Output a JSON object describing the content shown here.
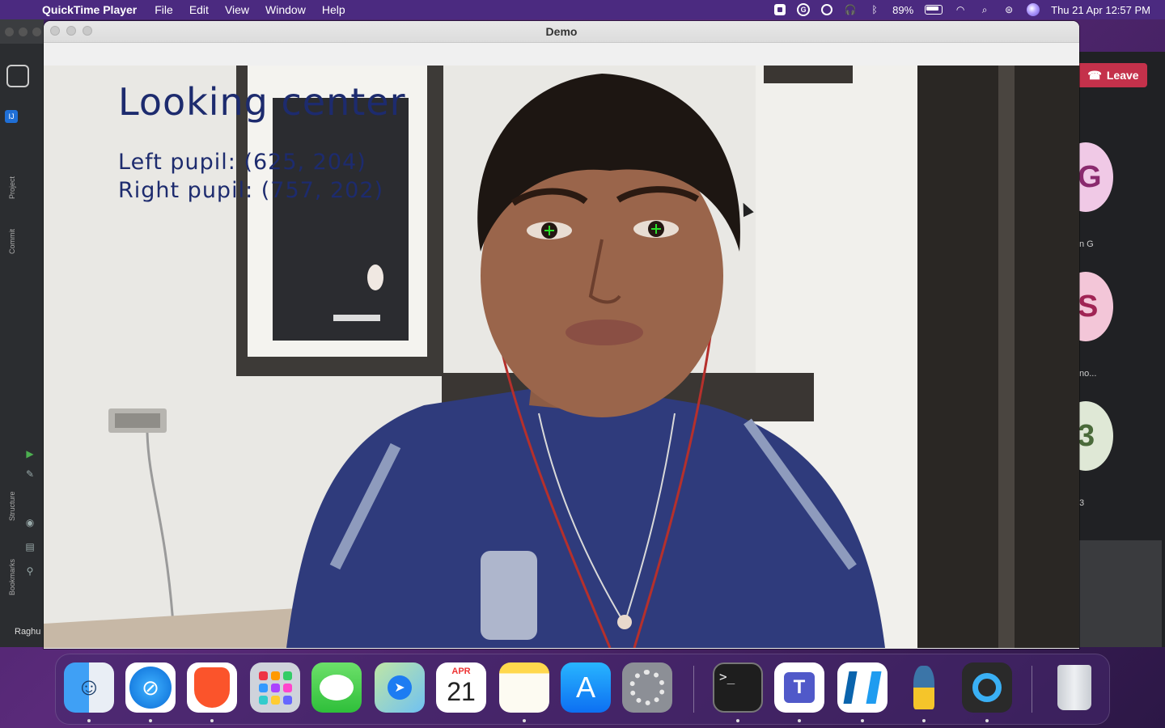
{
  "menubar": {
    "app_name": "QuickTime Player",
    "menus": [
      "File",
      "Edit",
      "View",
      "Window",
      "Help"
    ],
    "battery": "89%",
    "clock": "Thu 21 Apr  12:57 PM"
  },
  "window": {
    "title": "Demo"
  },
  "overlay": {
    "status": "Looking center",
    "left_pupil": "Left pupil:  (625, 204)",
    "right_pupil": "Right pupil: (757, 202)",
    "crosshair_color": "#2be02b"
  },
  "background_app_left": {
    "labels": [
      "Project",
      "Commit",
      "Structure",
      "Bookmarks"
    ],
    "user": "Raghu"
  },
  "background_app_right": {
    "leave_label": "Leave",
    "participants": [
      {
        "initial": "G",
        "name": "n G",
        "color": "#f0c9e6"
      },
      {
        "initial": "S",
        "name": "no...",
        "color": "#f3c6d8"
      },
      {
        "initial": "3",
        "name": "3",
        "color": "#dfe8d6"
      }
    ]
  },
  "dock": {
    "apps": [
      "Finder",
      "Safari",
      "Brave",
      "Launchpad",
      "Messages",
      "Maps",
      "Calendar",
      "Notes",
      "App Store",
      "System Preferences",
      "Terminal",
      "Teams",
      "Visual Studio Code",
      "Python",
      "QuickTime Player",
      "Trash"
    ],
    "calendar_month": "APR",
    "calendar_day": "21"
  }
}
